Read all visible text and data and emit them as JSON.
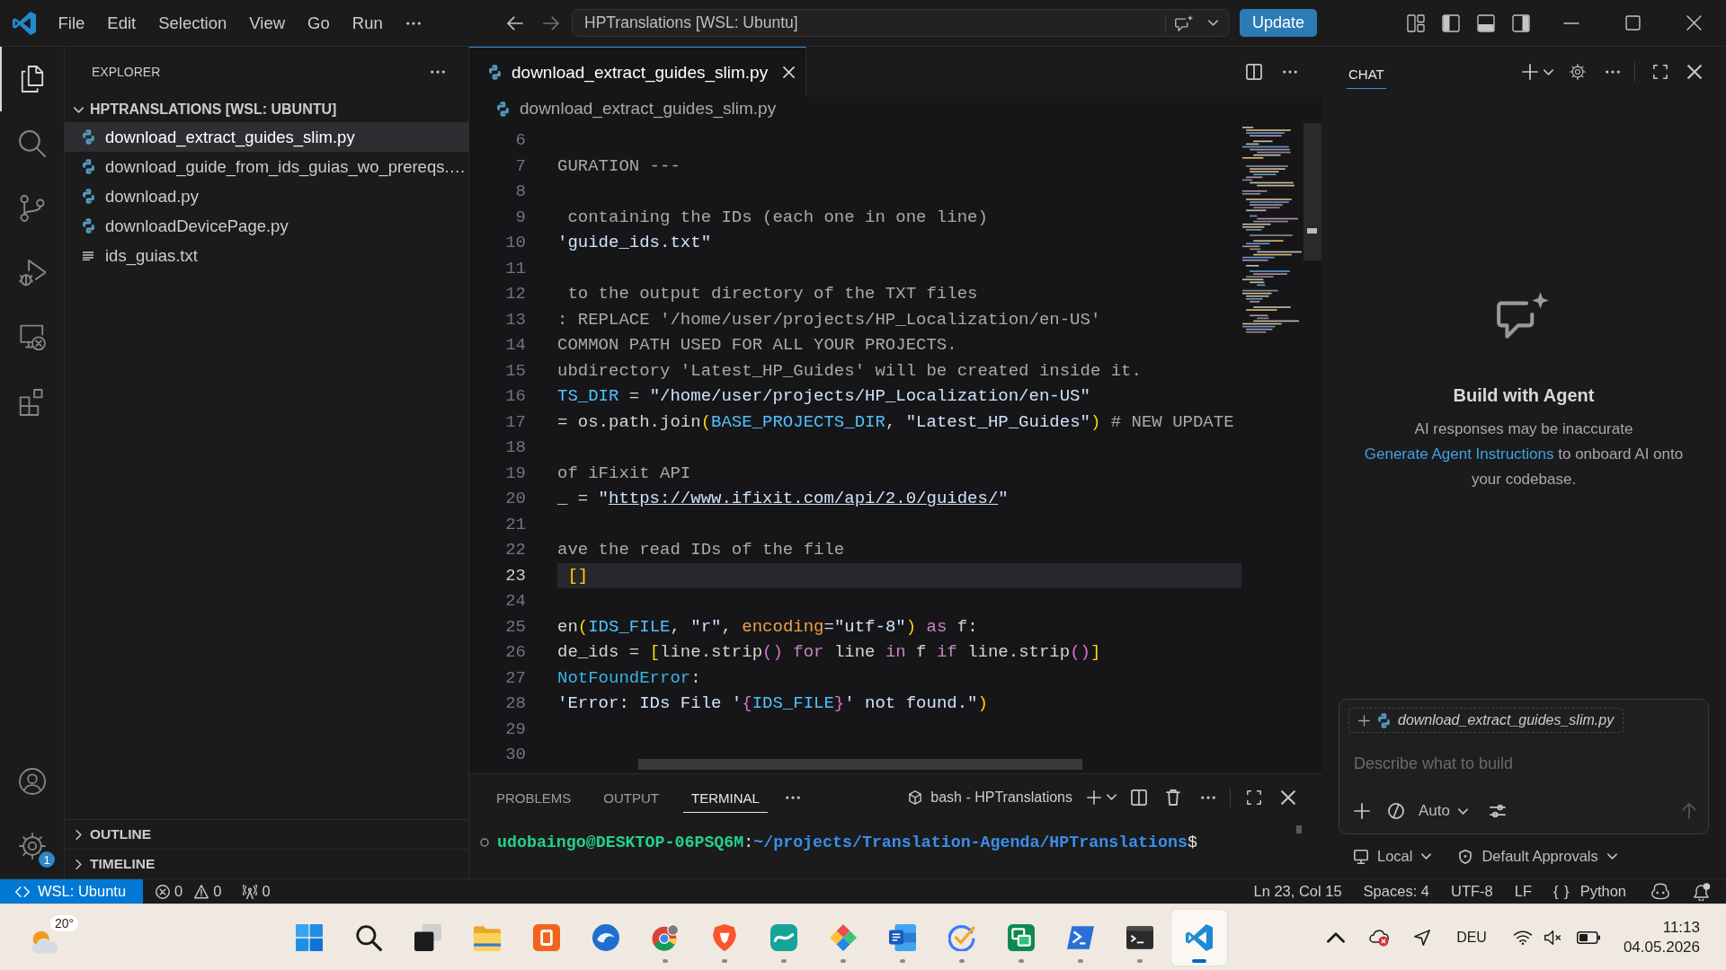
{
  "title_bar": {
    "menu": [
      "File",
      "Edit",
      "Selection",
      "View",
      "Go",
      "Run"
    ],
    "command_center": "HPTranslations [WSL: Ubuntu]",
    "update_button": "Update"
  },
  "activity_bar": {
    "items": [
      {
        "kind": "explorer",
        "selected": true
      },
      {
        "kind": "search",
        "selected": false
      },
      {
        "kind": "scm",
        "selected": false
      },
      {
        "kind": "debug",
        "selected": false
      },
      {
        "kind": "remote",
        "selected": false
      },
      {
        "kind": "extensions",
        "selected": false
      }
    ],
    "settings_badge": "1"
  },
  "explorer": {
    "title": "EXPLORER",
    "folder": {
      "name": "HPTRANSLATIONS [WSL: UBUNTU]",
      "expanded": true,
      "files": [
        {
          "name": "download_extract_guides_slim.py",
          "kind": "python",
          "selected": true
        },
        {
          "name": "download_guide_from_ids_guias_wo_prereqs.…",
          "kind": "python",
          "selected": false
        },
        {
          "name": "download.py",
          "kind": "python",
          "selected": false
        },
        {
          "name": "downloadDevicePage.py",
          "kind": "python",
          "selected": false
        },
        {
          "name": "ids_guias.txt",
          "kind": "text",
          "selected": false
        }
      ]
    },
    "sections": [
      {
        "name": "OUTLINE",
        "expanded": false
      },
      {
        "name": "TIMELINE",
        "expanded": false
      }
    ]
  },
  "editor": {
    "tabs": [
      {
        "label": "download_extract_guides_slim.py",
        "selected": true
      }
    ],
    "breadcrumb": "download_extract_guides_slim.py",
    "lines": [
      {
        "number": "6",
        "current": false
      },
      {
        "number": "7",
        "current": false,
        "tokens": [
          {
            "kind": "comment",
            "text": "GURATION ---"
          }
        ]
      },
      {
        "number": "8",
        "current": false
      },
      {
        "number": "9",
        "current": false,
        "tokens": [
          {
            "kind": "comment",
            "text": " containing the IDs (each one in one line)"
          }
        ]
      },
      {
        "number": "10",
        "current": false,
        "tokens": [
          {
            "kind": "string",
            "text": "'guide_ids.txt\""
          }
        ]
      },
      {
        "number": "11",
        "current": false
      },
      {
        "number": "12",
        "current": false,
        "tokens": [
          {
            "kind": "comment",
            "text": " to the output directory of the TXT files"
          }
        ]
      },
      {
        "number": "13",
        "current": false,
        "tokens": [
          {
            "kind": "comment",
            "text": ": REPLACE '/home/user/projects/HP_Localization/en-US'"
          }
        ]
      },
      {
        "number": "14",
        "current": false,
        "tokens": [
          {
            "kind": "comment",
            "text": "COMMON PATH USED FOR ALL YOUR PROJECTS."
          }
        ]
      },
      {
        "number": "15",
        "current": false,
        "tokens": [
          {
            "kind": "comment",
            "text": "ubdirectory 'Latest_HP_Guides' will be created inside it."
          }
        ]
      },
      {
        "number": "16",
        "current": false,
        "tokens": [
          {
            "kind": "constant",
            "text": "TS_DIR"
          },
          {
            "kind": "plain",
            "text": " = "
          },
          {
            "kind": "string",
            "text": "\"/home/user/projects/HP_Localization/en-US\""
          }
        ]
      },
      {
        "number": "17",
        "current": false,
        "tokens": [
          {
            "kind": "plain",
            "text": "= os.path.join"
          },
          {
            "kind": "bracket",
            "text": "("
          },
          {
            "kind": "constant",
            "text": "BASE_PROJECTS_DIR"
          },
          {
            "kind": "plain",
            "text": ", "
          },
          {
            "kind": "string",
            "text": "\"Latest_HP_Guides\""
          },
          {
            "kind": "bracket",
            "text": ")"
          },
          {
            "kind": "comment",
            "text": " # NEW UPDATE"
          }
        ]
      },
      {
        "number": "18",
        "current": false
      },
      {
        "number": "19",
        "current": false,
        "tokens": [
          {
            "kind": "comment",
            "text": "of iFixit API"
          }
        ]
      },
      {
        "number": "20",
        "current": false,
        "tokens": [
          {
            "kind": "plain",
            "text": "_ = "
          },
          {
            "kind": "string",
            "text": "\""
          },
          {
            "kind": "url",
            "text": "https://www.ifixit.com/api/2.0/guides/"
          },
          {
            "kind": "string",
            "text": "\""
          }
        ]
      },
      {
        "number": "21",
        "current": false
      },
      {
        "number": "22",
        "current": false,
        "tokens": [
          {
            "kind": "comment",
            "text": "ave the read IDs of the file"
          }
        ]
      },
      {
        "number": "23",
        "current": true,
        "tokens": [
          {
            "kind": "bracket",
            "text": " []"
          }
        ]
      },
      {
        "number": "24",
        "current": false
      },
      {
        "number": "25",
        "current": false,
        "tokens": [
          {
            "kind": "plain",
            "text": "en"
          },
          {
            "kind": "bracket",
            "text": "("
          },
          {
            "kind": "constant",
            "text": "IDS_FILE"
          },
          {
            "kind": "plain",
            "text": ", "
          },
          {
            "kind": "string",
            "text": "\"r\""
          },
          {
            "kind": "plain",
            "text": ", "
          },
          {
            "kind": "param",
            "text": "encoding"
          },
          {
            "kind": "plain",
            "text": "="
          },
          {
            "kind": "string",
            "text": "\"utf-8\""
          },
          {
            "kind": "bracket",
            "text": ")"
          },
          {
            "kind": "keyword",
            "text": " as"
          },
          {
            "kind": "plain",
            "text": " f:"
          }
        ]
      },
      {
        "number": "26",
        "current": false,
        "tokens": [
          {
            "kind": "plain",
            "text": "de_ids = "
          },
          {
            "kind": "bracket",
            "text": "["
          },
          {
            "kind": "plain",
            "text": "line.strip"
          },
          {
            "kind": "bracket2",
            "text": "()"
          },
          {
            "kind": "keyword",
            "text": " for"
          },
          {
            "kind": "plain",
            "text": " line "
          },
          {
            "kind": "keyword",
            "text": "in"
          },
          {
            "kind": "plain",
            "text": " f "
          },
          {
            "kind": "keyword",
            "text": "if"
          },
          {
            "kind": "plain",
            "text": " line.strip"
          },
          {
            "kind": "bracket2",
            "text": "()"
          },
          {
            "kind": "bracket",
            "text": "]"
          }
        ]
      },
      {
        "number": "27",
        "current": false,
        "tokens": [
          {
            "kind": "type",
            "text": "NotFoundError"
          },
          {
            "kind": "plain",
            "text": ":"
          }
        ]
      },
      {
        "number": "28",
        "current": false,
        "tokens": [
          {
            "kind": "string",
            "text": "'Error: IDs File '"
          },
          {
            "kind": "bracket2",
            "text": "{"
          },
          {
            "kind": "constant",
            "text": "IDS_FILE"
          },
          {
            "kind": "bracket2",
            "text": "}"
          },
          {
            "kind": "string",
            "text": "' not found.\""
          },
          {
            "kind": "bracket",
            "text": ")"
          }
        ]
      },
      {
        "number": "29",
        "current": false
      },
      {
        "number": "30",
        "current": false
      }
    ]
  },
  "panel": {
    "tabs": [
      {
        "label": "PROBLEMS",
        "selected": false
      },
      {
        "label": "OUTPUT",
        "selected": false
      },
      {
        "label": "TERMINAL",
        "selected": true
      }
    ],
    "terminal": {
      "name": "bash - HPTranslations",
      "prompt": [
        {
          "kind": "user",
          "text": "udobaingo@DESKTOP-06PSQ6M"
        },
        {
          "kind": "plain",
          "text": ":"
        },
        {
          "kind": "path",
          "text": "~/projects/Translation-Agenda/HPTranslations"
        },
        {
          "kind": "plain",
          "text": "$"
        }
      ]
    }
  },
  "chat": {
    "tabs": [
      {
        "label": "CHAT",
        "selected": true
      }
    ],
    "heading": "Build with Agent",
    "disclaimer": "AI responses may be inaccurate",
    "onboarding": {
      "link": "Generate Agent Instructions",
      "text": "to onboard AI onto your codebase."
    },
    "attachment": "download_extract_guides_slim.py",
    "input": {
      "placeholder": "Describe what to build"
    },
    "mode": "Auto",
    "send_disabled": true,
    "target": "Local",
    "approvals": "Default Approvals"
  },
  "status_bar": {
    "remote": "WSL: Ubuntu",
    "errors": "0",
    "warnings": "0",
    "ports": "0",
    "position": "Ln 23, Col 15",
    "indentation": "Spaces: 4",
    "encoding": "UTF-8",
    "line_ending": "LF",
    "language_icon": "{ }",
    "language": "Python",
    "unread_notifications": true
  },
  "taskbar": {
    "weather": "20°",
    "apps": [
      {
        "kind": "start",
        "running": false,
        "active": false
      },
      {
        "kind": "search",
        "running": false,
        "active": false
      },
      {
        "kind": "taskview",
        "running": false,
        "active": false
      },
      {
        "kind": "folder",
        "running": false,
        "active": false
      },
      {
        "kind": "box",
        "running": false,
        "active": false
      },
      {
        "kind": "bird",
        "running": false,
        "active": false
      },
      {
        "kind": "browser",
        "running": true,
        "active": false
      },
      {
        "kind": "shield",
        "running": true,
        "active": false
      },
      {
        "kind": "swoosh",
        "running": true,
        "active": false
      },
      {
        "kind": "diamonds",
        "running": true,
        "active": false
      },
      {
        "kind": "document",
        "running": true,
        "active": false
      },
      {
        "kind": "check",
        "running": true,
        "active": false
      },
      {
        "kind": "panels",
        "running": true,
        "active": false
      },
      {
        "kind": "shell",
        "running": true,
        "active": false
      },
      {
        "kind": "terminal",
        "running": true,
        "active": false
      },
      {
        "kind": "editor",
        "running": true,
        "active": true
      }
    ],
    "tray": {
      "language": "DEU",
      "cloud_error": true,
      "muted": true
    },
    "time": "11:13",
    "date": "04.05.2026"
  }
}
